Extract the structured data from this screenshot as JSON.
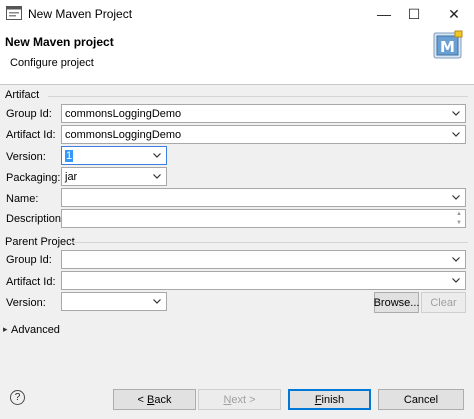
{
  "window": {
    "title": "New Maven Project",
    "minimize_glyph": "—",
    "maximize_glyph": "☐",
    "close_glyph": "✕"
  },
  "banner": {
    "title": "New Maven project",
    "subtitle": "Configure project",
    "logo_letter": "M"
  },
  "artifact": {
    "group_label": "Artifact",
    "group_id_label": "Group Id:",
    "group_id_value": "commonsLoggingDemo",
    "artifact_id_label": "Artifact Id:",
    "artifact_id_value": "commonsLoggingDemo",
    "version_label": "Version:",
    "version_value": "1",
    "packaging_label": "Packaging:",
    "packaging_value": "jar",
    "name_label": "Name:",
    "name_value": "",
    "description_label": "Description:",
    "description_value": ""
  },
  "parent": {
    "group_label": "Parent Project",
    "group_id_label": "Group Id:",
    "group_id_value": "",
    "artifact_id_label": "Artifact Id:",
    "artifact_id_value": "",
    "version_label": "Version:",
    "version_value": "",
    "browse_label": "Browse...",
    "clear_label": "Clear"
  },
  "advanced": {
    "label": "Advanced",
    "arrow_glyph": "▸"
  },
  "footer": {
    "help_glyph": "?",
    "back_prefix": "< ",
    "back_mnemonic": "B",
    "back_rest": "ack",
    "next_mnemonic": "N",
    "next_rest": "ext >",
    "finish_mnemonic": "F",
    "finish_rest": "inish",
    "cancel_label": "Cancel"
  },
  "colors": {
    "accent": "#0078d7",
    "selection": "#3399ff"
  }
}
